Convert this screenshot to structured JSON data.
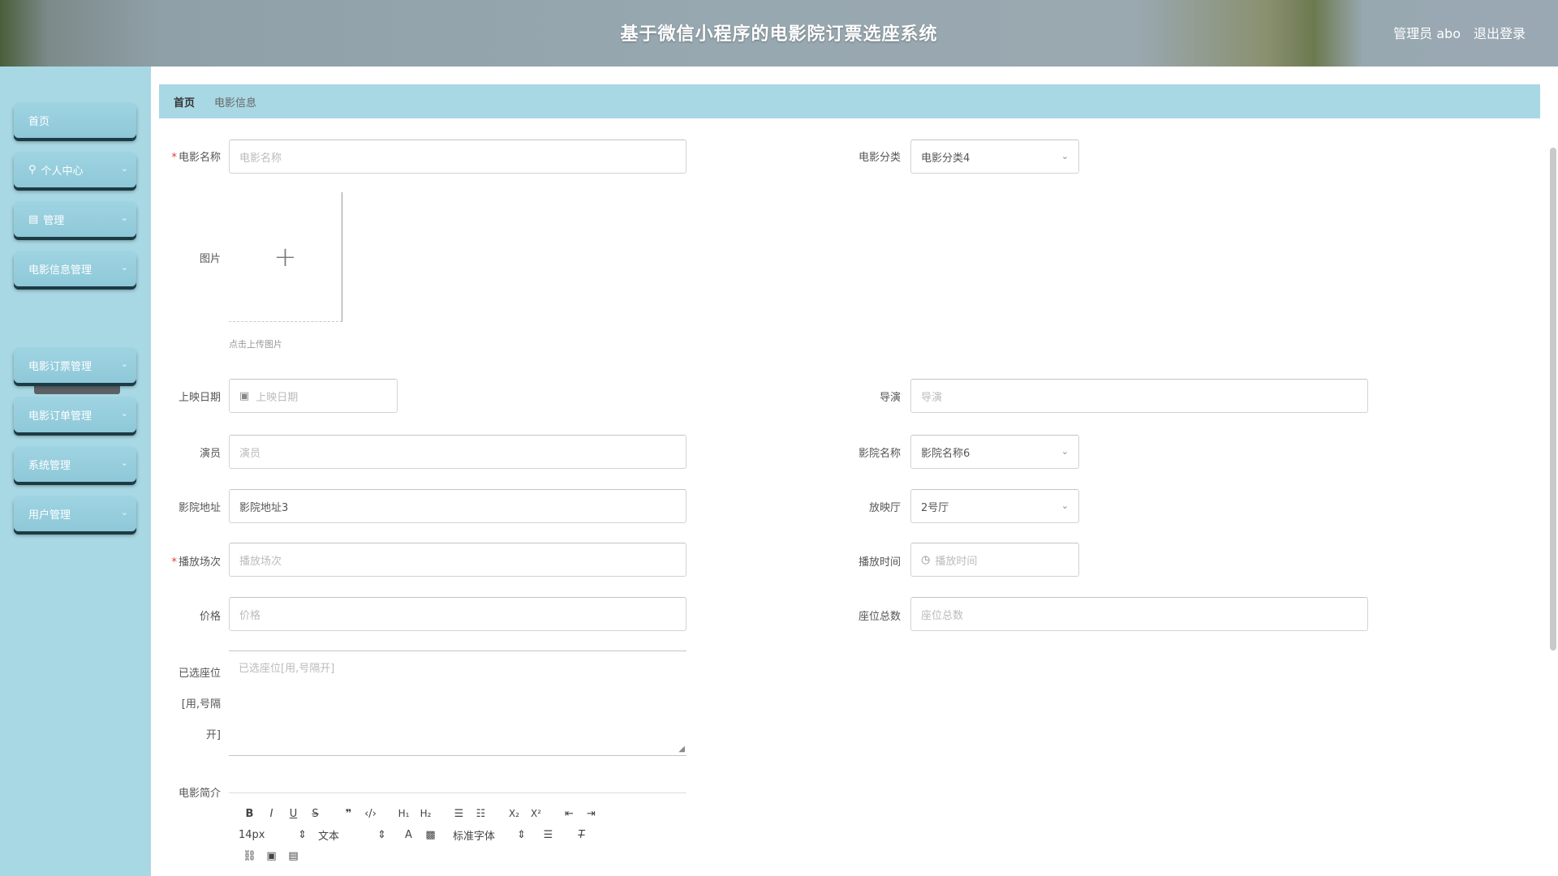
{
  "header": {
    "title": "基于微信小程序的电影院订票选座系统",
    "user": "管理员 abo",
    "logout": "退出登录"
  },
  "sidebar": {
    "items": [
      {
        "label": "首页"
      },
      {
        "label": "个人中心"
      },
      {
        "label": "管理"
      },
      {
        "label": "电影信息管理"
      },
      {
        "label": "电影订票管理"
      },
      {
        "label": "电影订单管理"
      },
      {
        "label": "系统管理"
      },
      {
        "label": "用户管理"
      }
    ],
    "active_sub": "电影信息"
  },
  "breadcrumb": {
    "home": "首页",
    "current": "电影信息"
  },
  "form": {
    "movie_name": {
      "label": "电影名称",
      "placeholder": "电影名称"
    },
    "category": {
      "label": "电影分类",
      "value": "电影分类4"
    },
    "image": {
      "label": "图片",
      "hint": "点击上传图片"
    },
    "release_date": {
      "label": "上映日期",
      "placeholder": "上映日期"
    },
    "director": {
      "label": "导演",
      "placeholder": "导演"
    },
    "actors": {
      "label": "演员",
      "placeholder": "演员"
    },
    "cinema_name": {
      "label": "影院名称",
      "value": "影院名称6"
    },
    "cinema_address": {
      "label": "影院地址",
      "value": "影院地址3"
    },
    "hall": {
      "label": "放映厅",
      "value": "2号厅"
    },
    "session": {
      "label": "播放场次",
      "placeholder": "播放场次"
    },
    "play_time": {
      "label": "播放时间",
      "placeholder": "播放时间"
    },
    "price": {
      "label": "价格",
      "placeholder": "价格"
    },
    "seat_total": {
      "label": "座位总数",
      "placeholder": "座位总数"
    },
    "booked_seats": {
      "label_1": "已选座位",
      "label_2": "[用,号隔",
      "label_3": "开]",
      "placeholder": "已选座位[用,号隔开]"
    },
    "intro": {
      "label": "电影简介"
    }
  },
  "editor": {
    "font_size": "14px",
    "text_type": "文本",
    "font_family": "标准字体"
  }
}
